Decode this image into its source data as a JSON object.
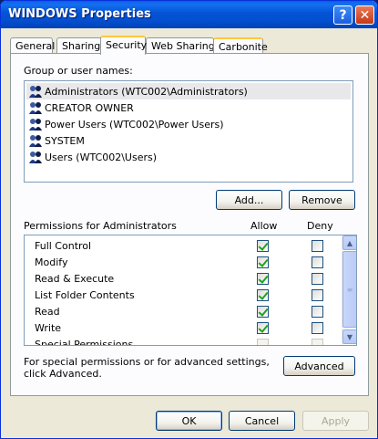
{
  "window": {
    "title": "WINDOWS Properties",
    "help_label": "?",
    "close_label": "✕"
  },
  "tabs": [
    {
      "label": "General"
    },
    {
      "label": "Sharing"
    },
    {
      "label": "Security",
      "active": true
    },
    {
      "label": "Web Sharing"
    },
    {
      "label": "Carbonite"
    }
  ],
  "security": {
    "group_label": "Group or user names:",
    "users": [
      {
        "name": "Administrators (WTC002\\Administrators)",
        "selected": true
      },
      {
        "name": "CREATOR OWNER"
      },
      {
        "name": "Power Users (WTC002\\Power Users)"
      },
      {
        "name": "SYSTEM"
      },
      {
        "name": "Users (WTC002\\Users)"
      }
    ],
    "add_label": "Add...",
    "remove_label": "Remove",
    "permissions_label": "Permissions for Administrators",
    "allow_label": "Allow",
    "deny_label": "Deny",
    "permissions": [
      {
        "name": "Full Control",
        "allow": true,
        "deny": false
      },
      {
        "name": "Modify",
        "allow": true,
        "deny": false
      },
      {
        "name": "Read & Execute",
        "allow": true,
        "deny": false
      },
      {
        "name": "List Folder Contents",
        "allow": true,
        "deny": false
      },
      {
        "name": "Read",
        "allow": true,
        "deny": false
      },
      {
        "name": "Write",
        "allow": true,
        "deny": false
      },
      {
        "name": "Special Permissions",
        "allow": false,
        "deny": false
      }
    ],
    "advanced_text_line1": "For special permissions or for advanced settings,",
    "advanced_text_line2": "click Advanced.",
    "advanced_label": "Advanced"
  },
  "footer": {
    "ok_label": "OK",
    "cancel_label": "Cancel",
    "apply_label": "Apply"
  }
}
